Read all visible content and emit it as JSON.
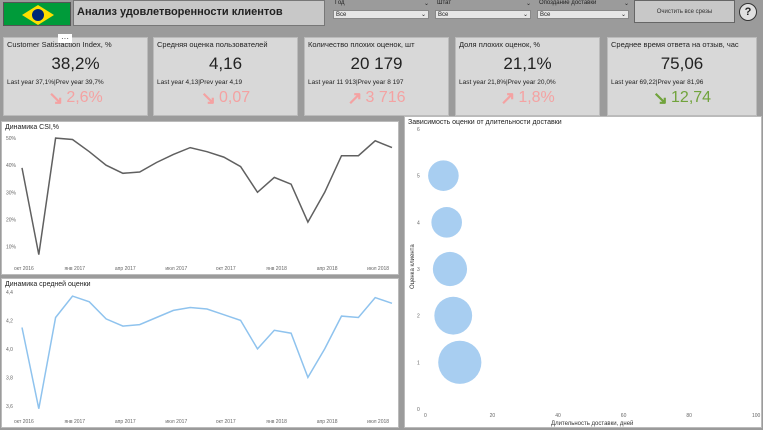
{
  "header": {
    "title": "Анализ удовлетворенности клиентов",
    "clear_button": "Очистить все срезы",
    "help": "?",
    "slicers": [
      {
        "label": "Год",
        "value": "Все"
      },
      {
        "label": "Штат",
        "value": "Все"
      },
      {
        "label": "Опоздание доставки",
        "value": "Все"
      }
    ],
    "more_options": "···"
  },
  "kpis": [
    {
      "title": "Customer Satisfaction Index, %",
      "value": "38,2%",
      "prev": "Last year 37,1%|Prev year 39,7%",
      "delta": "2,6%",
      "direction": "down",
      "status": "bad"
    },
    {
      "title": "Средняя оценка пользователей",
      "value": "4,16",
      "prev": "Last year 4,13|Prev year 4,19",
      "delta": "0,07",
      "direction": "down",
      "status": "bad"
    },
    {
      "title": "Количество плохих оценок, шт",
      "value": "20 179",
      "prev": "Last year 11 913|Prev year 8 197",
      "delta": "3 716",
      "direction": "up",
      "status": "bad"
    },
    {
      "title": "Доля плохих оценок, %",
      "value": "21,1%",
      "prev": "Last year 21,8%|Prev year 20,0%",
      "delta": "1,8%",
      "direction": "up",
      "status": "bad"
    },
    {
      "title": "Среднее время ответа на отзыв, час",
      "value": "75,06",
      "prev": "Last year 69,22|Prev year 81,96",
      "delta": "12,74",
      "direction": "down",
      "status": "good"
    }
  ],
  "colors": {
    "bad": "#f4a2a2",
    "good": "#71a33c",
    "csi_line": "#606060",
    "rating_line": "#8fc3ee",
    "bubble": "#9fc9f0"
  },
  "chart_data": [
    {
      "type": "line",
      "title": "Динамика CSI,%",
      "x_ticks": [
        "окт 2016",
        "янв 2017",
        "апр 2017",
        "июл 2017",
        "окт 2017",
        "янв 2018",
        "апр 2018",
        "июл 2018"
      ],
      "y_ticks": [
        "10%",
        "20%",
        "30%",
        "40%",
        "50%"
      ],
      "ylim": [
        5,
        53
      ],
      "series": [
        {
          "values": [
            39,
            7,
            50,
            49.5,
            45,
            40,
            37,
            37.5,
            41,
            44,
            46.5,
            45,
            43,
            39.5,
            30,
            35.5,
            33,
            19,
            30,
            43.5,
            43.5,
            49,
            46.5
          ]
        }
      ]
    },
    {
      "type": "line",
      "title": "Динамика средней оценки",
      "x_ticks": [
        "окт 2016",
        "янв 2017",
        "апр 2017",
        "июл 2017",
        "окт 2017",
        "янв 2018",
        "апр 2018",
        "июл 2018"
      ],
      "y_ticks": [
        "3,6",
        "3,8",
        "4,0",
        "4,2",
        "4,4"
      ],
      "ylim": [
        3.55,
        4.42
      ],
      "series": [
        {
          "values": [
            4.15,
            3.58,
            4.22,
            4.37,
            4.33,
            4.21,
            4.16,
            4.17,
            4.22,
            4.27,
            4.29,
            4.28,
            4.24,
            4.2,
            4.0,
            4.13,
            4.11,
            3.8,
            4.0,
            4.23,
            4.22,
            4.36,
            4.32
          ]
        }
      ]
    },
    {
      "type": "scatter",
      "title": "Зависимость оценки от длительности доставки",
      "xlabel": "Длительность доставки, дней",
      "ylabel": "Оценка клиента",
      "x_ticks": [
        "0",
        "20",
        "40",
        "60",
        "80",
        "100"
      ],
      "y_ticks": [
        "0",
        "1",
        "2",
        "3",
        "4",
        "5",
        "6"
      ],
      "xlim": [
        0,
        100
      ],
      "ylim": [
        0,
        6
      ],
      "points": [
        {
          "x": 5,
          "y": 5,
          "size": 0.85
        },
        {
          "x": 6,
          "y": 4,
          "size": 0.85
        },
        {
          "x": 7,
          "y": 3,
          "size": 0.95
        },
        {
          "x": 8,
          "y": 2,
          "size": 1.05
        },
        {
          "x": 10,
          "y": 1,
          "size": 1.2
        }
      ]
    }
  ]
}
